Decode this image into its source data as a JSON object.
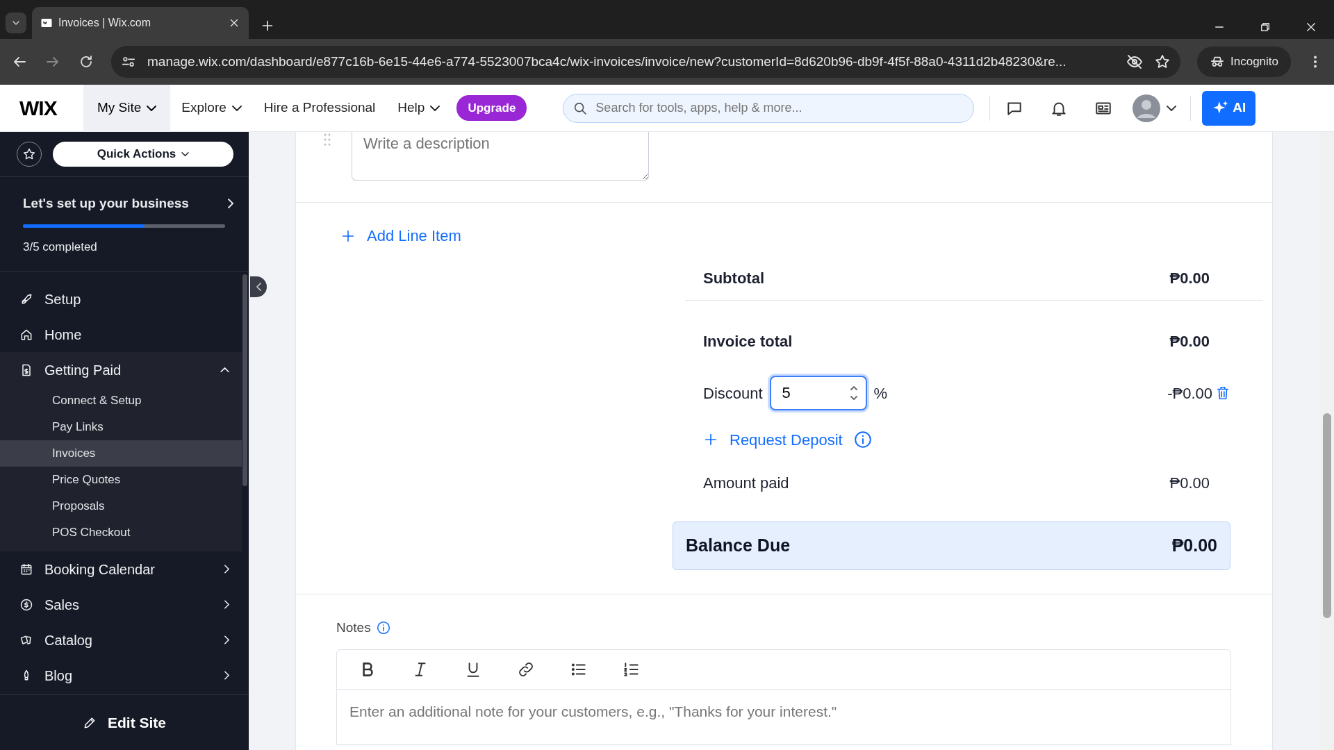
{
  "browser": {
    "tabs": [
      {
        "title": "Invoices | Wix.com",
        "selected": true
      }
    ],
    "url": "manage.wix.com/dashboard/e877c16b-6e15-44e6-a774-5523007bca4c/wix-invoices/invoice/new?customerId=8d620b96-db9f-4f5f-88a0-4311d2b48230&re...",
    "profile": "Incognito"
  },
  "header": {
    "logo": "WIX",
    "nav": [
      {
        "label": "My Site",
        "dropdown": true
      },
      {
        "label": "Explore",
        "dropdown": true
      },
      {
        "label": "Hire a Professional",
        "dropdown": false
      },
      {
        "label": "Help",
        "dropdown": true
      }
    ],
    "upgrade": "Upgrade",
    "search": {
      "placeholder": "Search for tools, apps, help & more..."
    },
    "ai": "AI"
  },
  "sidebar": {
    "quick_actions": "Quick Actions",
    "setup": {
      "title": "Let's set up your business",
      "level": 0.6,
      "completed": "3/5 completed"
    },
    "items": [
      {
        "label": "Setup"
      },
      {
        "label": "Home"
      },
      {
        "label": "Getting Paid",
        "expanded": true,
        "children": [
          {
            "label": "Connect & Setup",
            "selected": false
          },
          {
            "label": "Pay Links",
            "selected": false
          },
          {
            "label": "Invoices",
            "selected": true
          },
          {
            "label": "Price Quotes",
            "selected": false
          },
          {
            "label": "Proposals",
            "selected": false
          },
          {
            "label": "POS Checkout",
            "selected": false
          }
        ]
      },
      {
        "label": "Booking Calendar",
        "expanded": false
      },
      {
        "label": "Sales",
        "expanded": false
      },
      {
        "label": "Catalog",
        "expanded": false
      },
      {
        "label": "Blog",
        "expanded": false
      }
    ],
    "edit_site": "Edit Site"
  },
  "invoice": {
    "description": {
      "placeholder": "Write a description"
    },
    "add_line_item": "Add Line Item",
    "subtotal": {
      "label": "Subtotal",
      "value": "₱0.00"
    },
    "invoice_total": {
      "label": "Invoice total",
      "value": "₱0.00"
    },
    "discount": {
      "label": "Discount",
      "value": "5",
      "unit": "%",
      "amount": "-₱0.00"
    },
    "request_deposit": "Request Deposit",
    "amount_paid": {
      "label": "Amount paid",
      "value": "₱0.00"
    },
    "balance_due": {
      "label": "Balance Due",
      "value": "₱0.00"
    },
    "notes": {
      "label": "Notes",
      "placeholder": "Enter an additional note for your customers, e.g., \"Thanks for your interest.\""
    }
  }
}
